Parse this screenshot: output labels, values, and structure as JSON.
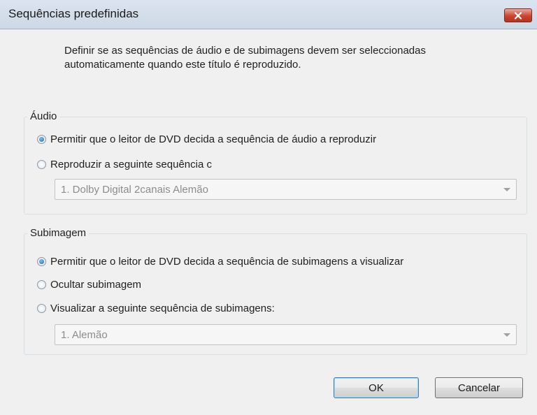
{
  "window": {
    "title": "Sequências predefinidas",
    "close_icon": "close-icon"
  },
  "description": "Definir se as sequências de áudio e de subimagens devem ser seleccionadas automaticamente quando este título é reproduzido.",
  "audio": {
    "group_label": "Áudio",
    "options": [
      {
        "label": "Permitir que o leitor de DVD decida a sequência de áudio a reproduzir",
        "checked": true
      },
      {
        "label": "Reproduzir a seguinte sequência c",
        "checked": false
      }
    ],
    "dropdown": {
      "value": "1. Dolby Digital 2canais Alemão",
      "enabled": false
    }
  },
  "subpicture": {
    "group_label": "Subimagem",
    "options": [
      {
        "label": "Permitir que o leitor de DVD decida a sequência de subimagens a visualizar",
        "checked": true
      },
      {
        "label": "Ocultar subimagem",
        "checked": false
      },
      {
        "label": "Visualizar a seguinte sequência de subimagens:",
        "checked": false
      }
    ],
    "dropdown": {
      "value": "1. Alemão",
      "enabled": false
    }
  },
  "buttons": {
    "ok": "OK",
    "cancel": "Cancelar"
  },
  "colors": {
    "title_bar": "#d3dde9",
    "close_button": "#c9452f",
    "dialog_background": "#f0f0f0",
    "radio_selected": "#1d64a8"
  }
}
